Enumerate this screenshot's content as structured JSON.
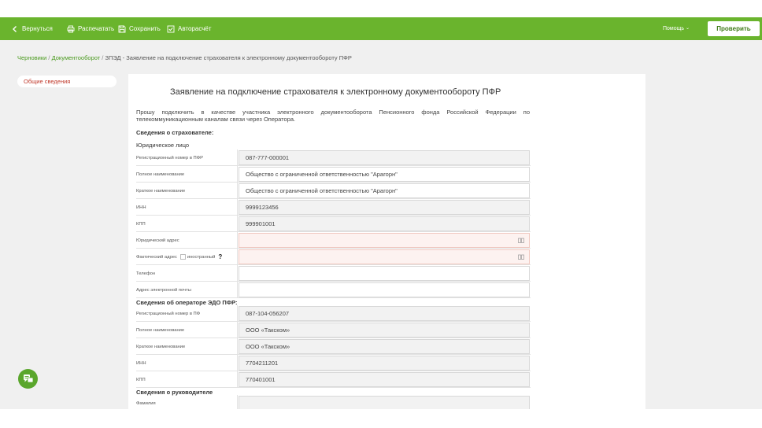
{
  "toolbar": {
    "back_label": "Вернуться",
    "print_label": "Распечатать",
    "save_label": "Сохранить",
    "autocalc_label": "Авторасчёт",
    "help_label": "Помощь",
    "help_chevron": "⌄",
    "check_label": "Проверить"
  },
  "breadcrumb": {
    "item1": "Черновики",
    "item2": "Документооборот",
    "current": "ЗПЭД - Заявление на подключение страхователя к электронному документообороту ПФР",
    "sep": " / "
  },
  "sidebar": {
    "items": [
      {
        "label": "Общие сведения"
      }
    ]
  },
  "form": {
    "title": "Заявление на подключение страхователя к электронному документообороту ПФР",
    "intro": "Прошу подключить в качестве участника электронного документооборота Пенсионного фонда Российской Федерации по телекоммуникационным каналам связи через Оператора.",
    "insurer_heading": "Сведения о страхователе:",
    "legal_entity_label": "Юридическое лицо",
    "insurer_rows": [
      {
        "label": "Регистрационный номер в ПФР",
        "value": "087-777-000001"
      },
      {
        "label": "Полное наименование",
        "value": "Общество с ограниченной ответственностью \"Арагорн\""
      },
      {
        "label": "Краткое наименование",
        "value": "Общество с ограниченной ответственностью \"Арагорн\""
      },
      {
        "label": "ИНН",
        "value": "9999123456"
      },
      {
        "label": "КПП",
        "value": "999901001"
      },
      {
        "label": "Юридический адрес",
        "value": ""
      },
      {
        "label": "Фактический адрес",
        "value": ""
      },
      {
        "label": "Телефон",
        "value": ""
      },
      {
        "label": "Адрес электронной почты",
        "value": ""
      }
    ],
    "foreign_label": "иностранный",
    "help_mark": "?",
    "operator_heading": "Сведения об операторе ЭДО ПФР:",
    "operator_rows": [
      {
        "label": "Регистрационный номер в ПФ",
        "value": "087-104-056207"
      },
      {
        "label": "Полное наименование",
        "value": "ООО «Такском»"
      },
      {
        "label": "Краткое наименование",
        "value": "ООО «Такском»"
      },
      {
        "label": "ИНН",
        "value": "7704211201"
      },
      {
        "label": "КПП",
        "value": "770401001"
      }
    ],
    "director_heading": "Сведения о руководителе",
    "director_rows": [
      {
        "label": "Фамилия",
        "value": ""
      }
    ]
  },
  "colors": {
    "accent": "#6ab42d",
    "error_field": "#fdf2f0",
    "link": "#4a9a1e",
    "sidebar_active": "#c0392b"
  }
}
